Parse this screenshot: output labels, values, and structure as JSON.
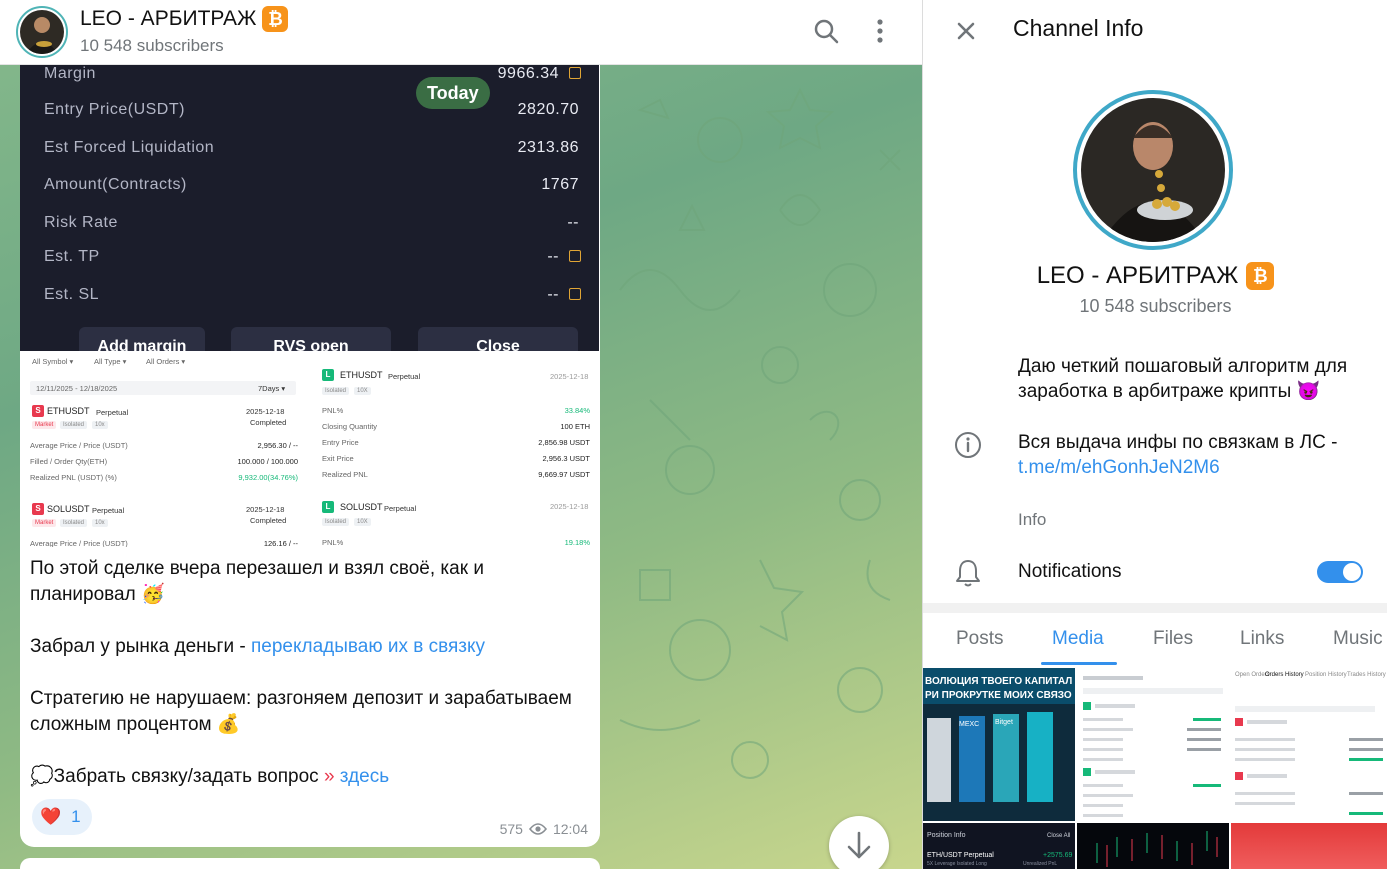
{
  "colors": {
    "accent": "#3390ec",
    "bitcoin": "#f7931a",
    "trade_panel_bg": "#1b1d2b",
    "green": "#16b979",
    "red": "#e8394e"
  },
  "header": {
    "title": "LEO - АРБИТРАЖ",
    "badge": "₿",
    "subscribers": "10 548 subscribers",
    "icons": {
      "search": "search-icon",
      "more": "more-vertical-icon"
    }
  },
  "date_pill": "Today",
  "trade_panel": {
    "rows": [
      {
        "label": "Margin",
        "value": "9966.34",
        "editable": true
      },
      {
        "label": "Entry Price(USDT)",
        "value": "2820.70"
      },
      {
        "label": "Est Forced Liquidation",
        "value": "2313.86"
      },
      {
        "label": "Amount(Contracts)",
        "value": "1767"
      },
      {
        "label": "Risk Rate",
        "value": "--"
      },
      {
        "label": "Est. TP",
        "value": "--",
        "editable": true
      },
      {
        "label": "Est. SL",
        "value": "--",
        "editable": true
      }
    ],
    "buttons": [
      "Add margin",
      "RVS open",
      "Close"
    ]
  },
  "screenshot": {
    "filters": [
      "All Symbol ▾",
      "All Type ▾",
      "All Orders ▾"
    ],
    "date_range": "12/11/2025 - 12/18/2025",
    "period": "7Days ▾",
    "orders": [
      {
        "icon": "S",
        "symbol": "ETHUSDT",
        "kind": "Perpetual",
        "tags": [
          "Market",
          "Isolated",
          "10x"
        ],
        "date": "2025-12-18",
        "status": "Completed",
        "lines": [
          [
            "Average Price / Price (USDT)",
            "2,956.30 / --"
          ],
          [
            "Filled / Order Qty(ETH)",
            "100.000 / 100.000"
          ],
          [
            "Realized PNL (USDT) (%)",
            "9,932.00(34.76%)"
          ]
        ]
      },
      {
        "icon": "S",
        "symbol": "SOLUSDT",
        "kind": "Perpetual",
        "tags": [
          "Market",
          "Isolated",
          "10x"
        ],
        "date": "2025-12-18",
        "status": "Completed",
        "lines": [
          [
            "Average Price / Price (USDT)",
            "126.16 / --"
          ]
        ]
      }
    ],
    "positions": [
      {
        "icon": "L",
        "symbol": "ETHUSDT",
        "kind": "Perpetual",
        "tags": [
          "Isolated",
          "10X"
        ],
        "date": "2025-12-18",
        "lines": [
          [
            "PNL%",
            "33.84%"
          ],
          [
            "Closing Quantity",
            "100 ETH"
          ],
          [
            "Entry Price",
            "2,856.98 USDT"
          ],
          [
            "Exit Price",
            "2,956.3 USDT"
          ],
          [
            "Realized PNL",
            "9,669.97 USDT"
          ]
        ]
      },
      {
        "icon": "L",
        "symbol": "SOLUSDT",
        "kind": "Perpetual",
        "tags": [
          "Isolated",
          "10X"
        ],
        "date": "2025-12-18",
        "lines": [
          [
            "PNL%",
            "19.18%"
          ]
        ]
      }
    ]
  },
  "message": {
    "p1": "По этой сделке вчера перезашел и взял своё, как и планировал 🥳",
    "p2_text": "Забрал у рынка деньги - ",
    "p2_link": "перекладываю их в связку",
    "p3": "Стратегию не нарушаем: разгоняем депозит и зарабатываем сложным процентом 💰",
    "cta_icon": "💭",
    "cta_text": "Забрать связку/задать вопрос",
    "cta_arrows": "»",
    "cta_link": "здесь",
    "reaction_emoji": "❤️",
    "reaction_count": "1",
    "views": "575",
    "time": "12:04"
  },
  "info_panel": {
    "title": "Channel Info",
    "name": "LEO - АРБИТРАЖ",
    "badge": "₿",
    "subscribers": "10 548 subscribers",
    "description_1": "Даю четкий пошаговый алгоритм для заработка в арбитраже крипты 😈",
    "description_2": "Вся выдача инфы по связкам в ЛС - ",
    "link": "t.me/m/ehGonhJeN2M6",
    "info_label": "Info",
    "notifications_label": "Notifications",
    "notifications_on": true,
    "tabs": [
      "Posts",
      "Media",
      "Files",
      "Links",
      "Music"
    ],
    "active_tab": "Media",
    "thumb1_caption": "ВОЛЮЦИЯ ТВОЕГО КАПИТАЛ\nРИ ПРОКРУТКЕ МОИХ СВЯЗО",
    "thumb1_brands": [
      "MEXC",
      "Bitget"
    ],
    "thumb3_tabs": [
      "Open Orders",
      "Orders History",
      "Position History",
      "Trades History"
    ],
    "thumb4_text": [
      "Position Info",
      "Close All",
      "ETH/USDT Perpetual",
      "+2575.69",
      "5X Leverage  Isolated Long",
      "Unrealized PnL"
    ]
  }
}
